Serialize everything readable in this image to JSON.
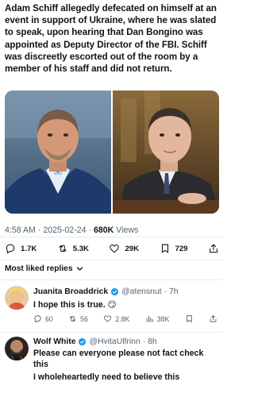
{
  "tweet": {
    "text": "Adam Schiff allegedly defecated on himself at an event in support of Ukraine, where he was slated to speak, upon hearing that Dan Bongino was appointed as Deputy Director of the FBI. Schiff was discreetly escorted out of the room by a member of his staff and did not return.",
    "time": "4:58 AM",
    "separator": "·",
    "date": "2025-02-24",
    "views_count": "680K",
    "views_label": "Views",
    "replies": "1.7K",
    "reposts": "5.3K",
    "likes": "29K",
    "bookmarks": "729"
  },
  "sort": {
    "label": "Most liked replies"
  },
  "replies": [
    {
      "name": "Juanita Broaddrick",
      "handle": "@atensnut",
      "sep": "·",
      "time": "7h",
      "text": "I hope this is true. 😏",
      "replies": "60",
      "reposts": "56",
      "likes": "2.8K",
      "views": "38K"
    },
    {
      "name": "Wolf White",
      "handle": "@HvitaUlfrinn",
      "sep": "·",
      "time": "8h",
      "text_line1": "Please can everyone please not fact check this",
      "text_line2": "I wholeheartedly need to believe this"
    }
  ],
  "colors": {
    "text": "#0f1419",
    "secondary": "#536471",
    "verified": "#1d9bf0"
  }
}
